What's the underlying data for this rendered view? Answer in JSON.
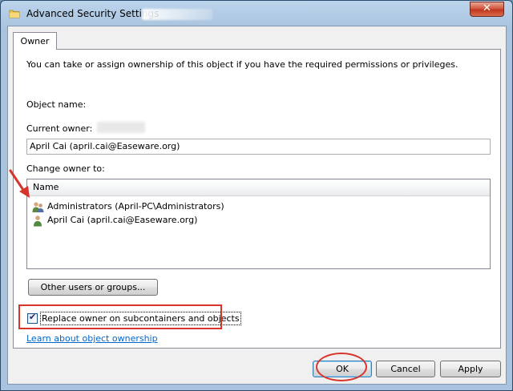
{
  "window": {
    "title": "Advanced Security Settings"
  },
  "titlebar": {
    "close_glyph": "✕"
  },
  "tabs": [
    {
      "label": "Owner"
    }
  ],
  "owner": {
    "description": "You can take or assign ownership of this object if you have the required permissions or privileges.",
    "object_name_label": "Object name:",
    "current_owner_label": "Current owner:",
    "current_owner_value": "April Cai (april.cai@Easeware.org)",
    "change_owner_label": "Change owner to:",
    "list": {
      "column_header": "Name",
      "items": [
        {
          "label": "Administrators (April-PC\\Administrators)",
          "icon": "user-group-icon"
        },
        {
          "label": "April Cai (april.cai@Easeware.org)",
          "icon": "user-icon"
        }
      ]
    },
    "other_users_button": "Other users or groups...",
    "replace_owner_checkbox": {
      "label": "Replace owner on subcontainers and objects",
      "checked": true,
      "check_glyph": "✔"
    },
    "learn_link": "Learn about object ownership"
  },
  "footer": {
    "ok_label": "OK",
    "cancel_label": "Cancel",
    "apply_label": "Apply"
  },
  "colors": {
    "annotation_red": "#d9342b",
    "link_blue": "#0066cc",
    "close_red": "#c0341c"
  }
}
